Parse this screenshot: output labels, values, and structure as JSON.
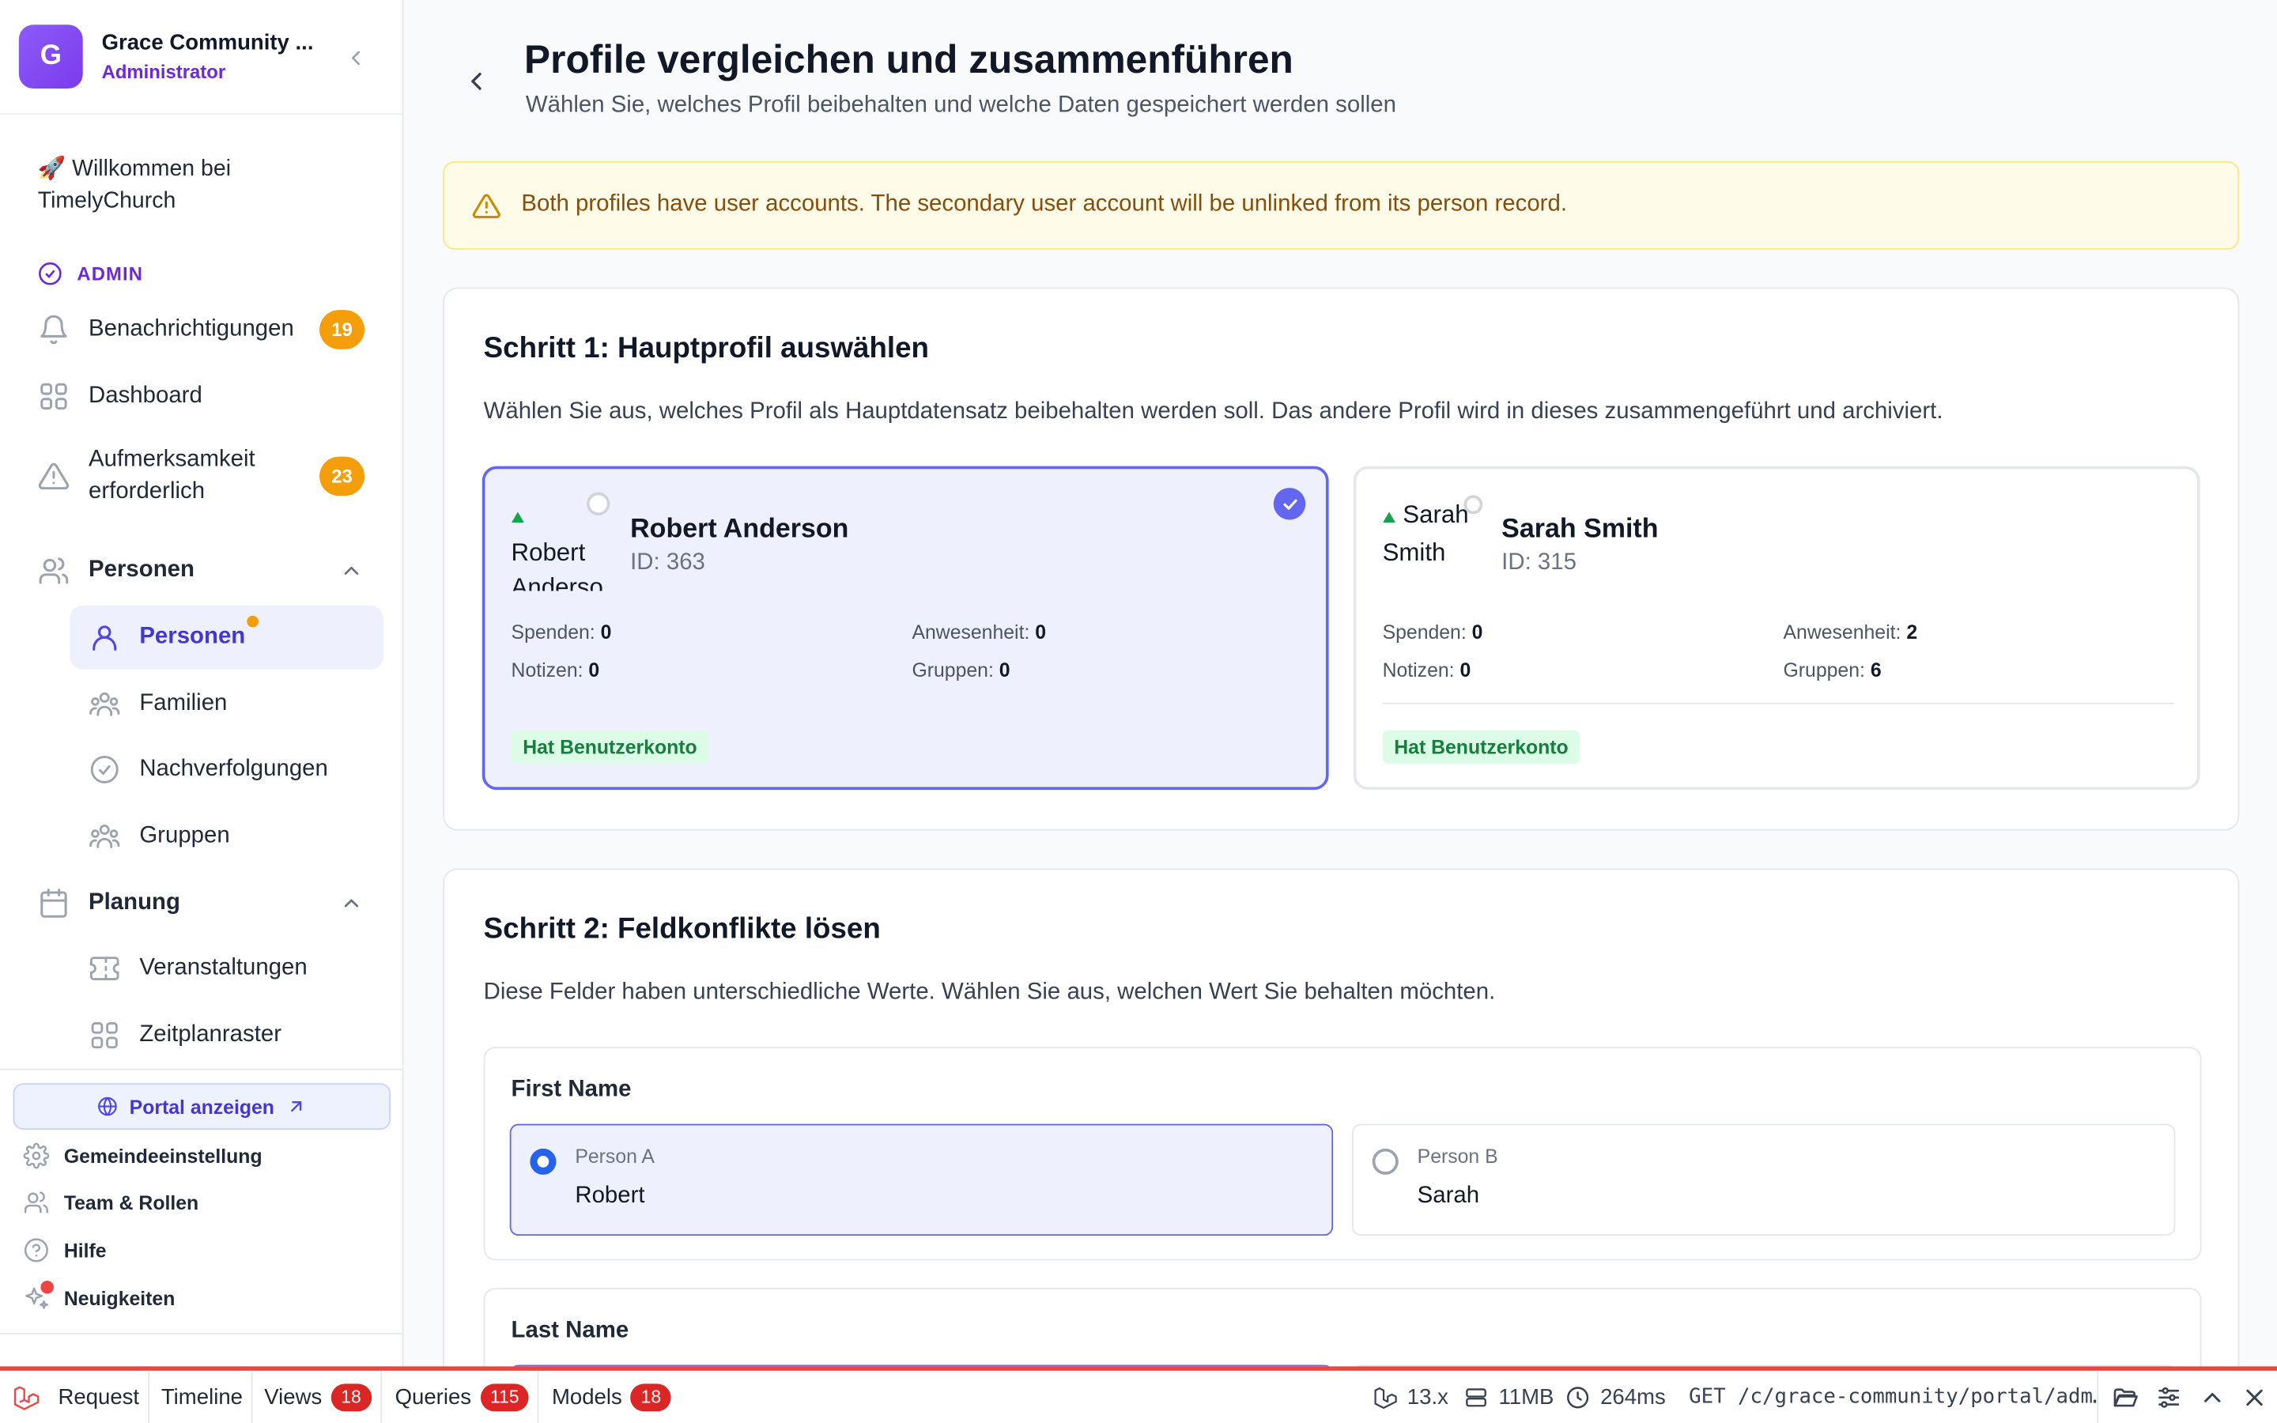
{
  "sidebar": {
    "org_initial": "G",
    "org_name": "Grace Community ...",
    "org_role": "Administrator",
    "welcome": "🚀 Willkommen bei TimelyChurch",
    "admin_label": "ADMIN",
    "nav": {
      "notifications": {
        "label": "Benachrichtigungen",
        "badge": "19"
      },
      "dashboard": {
        "label": "Dashboard"
      },
      "attention": {
        "label": "Aufmerksamkeit erforderlich",
        "badge": "23"
      },
      "people_section": {
        "label": "Personen"
      },
      "people": {
        "label": "Personen"
      },
      "families": {
        "label": "Familien"
      },
      "followups": {
        "label": "Nachverfolgungen"
      },
      "groups": {
        "label": "Gruppen"
      },
      "planning_section": {
        "label": "Planung"
      },
      "events": {
        "label": "Veranstaltungen"
      },
      "schedule": {
        "label": "Zeitplanraster"
      }
    },
    "portal_button": "Portal anzeigen",
    "footer": {
      "settings": "Gemeindeeinstellung",
      "team": "Team & Rollen",
      "help": "Hilfe",
      "news": "Neuigkeiten"
    }
  },
  "page": {
    "title": "Profile vergleichen und zusammenführen",
    "subtitle": "Wählen Sie, welches Profil beibehalten und welche Daten gespeichert werden sollen"
  },
  "alert": {
    "text": "Both profiles have user accounts. The secondary user account will be unlinked from its person record."
  },
  "step1": {
    "title": "Schritt 1: Hauptprofil auswählen",
    "description": "Wählen Sie aus, welches Profil als Hauptdatensatz beibehalten werden soll. Das andere Profil wird in dieses zusammengeführt und archiviert.",
    "profiles": [
      {
        "img_alt": "Robert Anderson",
        "name": "Robert Anderson",
        "id": "ID: 363",
        "donations_label": "Spenden:",
        "donations": "0",
        "attendance_label": "Anwesenheit:",
        "attendance": "0",
        "notes_label": "Notizen:",
        "notes": "0",
        "groups_label": "Gruppen:",
        "groups": "0",
        "account_badge": "Hat Benutzerkonto",
        "selected": true
      },
      {
        "img_alt": "Sarah Smith",
        "name": "Sarah Smith",
        "id": "ID: 315",
        "donations_label": "Spenden:",
        "donations": "0",
        "attendance_label": "Anwesenheit:",
        "attendance": "2",
        "notes_label": "Notizen:",
        "notes": "0",
        "groups_label": "Gruppen:",
        "groups": "6",
        "account_badge": "Hat Benutzerkonto",
        "selected": false
      }
    ]
  },
  "step2": {
    "title": "Schritt 2: Feldkonflikte lösen",
    "description": "Diese Felder haben unterschiedliche Werte. Wählen Sie aus, welchen Wert Sie behalten möchten.",
    "fields": [
      {
        "name": "First Name",
        "option_a": {
          "label": "Person A",
          "value": "Robert",
          "selected": true
        },
        "option_b": {
          "label": "Person B",
          "value": "Sarah",
          "selected": false
        }
      },
      {
        "name": "Last Name"
      }
    ]
  },
  "debugbar": {
    "tabs": [
      {
        "label": "Request"
      },
      {
        "label": "Timeline"
      },
      {
        "label": "Views",
        "count": "18"
      },
      {
        "label": "Queries",
        "count": "115"
      },
      {
        "label": "Models",
        "count": "18"
      }
    ],
    "version": "13.x",
    "memory": "11MB",
    "duration": "264ms",
    "route": "GET /c/grace-community/portal/adm…"
  },
  "colors": {
    "brand": "#7c3aed",
    "accent": "#6366f1",
    "badge_orange": "#f59e0b",
    "debug_red": "#dc2626",
    "success_bg": "#dcfce7"
  }
}
